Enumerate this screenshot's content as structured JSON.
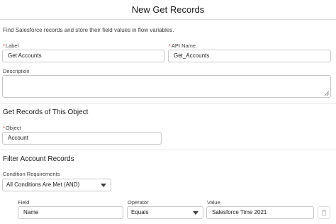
{
  "modal": {
    "title": "New Get Records"
  },
  "intro": "Find Salesforce records and store their field values in flow variables.",
  "fields": {
    "label": {
      "required_mark": "*",
      "label": "Label",
      "value": "Get Accounts"
    },
    "api_name": {
      "required_mark": "*",
      "label": "API Name",
      "value": "Get_Accounts"
    },
    "description": {
      "label": "Description",
      "value": ""
    }
  },
  "object_section": {
    "title": "Get Records of This Object",
    "object": {
      "required_mark": "*",
      "label": "Object",
      "value": "Account"
    }
  },
  "filter_section": {
    "title": "Filter Account Records",
    "condition_requirements": {
      "label": "Condition Requirements",
      "value": "All Conditions Are Met (AND)"
    },
    "columns": {
      "field": "Field",
      "operator": "Operator",
      "value": "Value"
    },
    "condition": {
      "field": "Name",
      "operator": "Equals",
      "value": "Salesforce Time 2021"
    }
  },
  "icons": {
    "delete": "trash-icon",
    "dropdown": "chevron-down-icon",
    "resize": "resize-handle-icon"
  },
  "colors": {
    "required": "#c23934",
    "border": "#c9c7c5",
    "text": "#181818"
  }
}
